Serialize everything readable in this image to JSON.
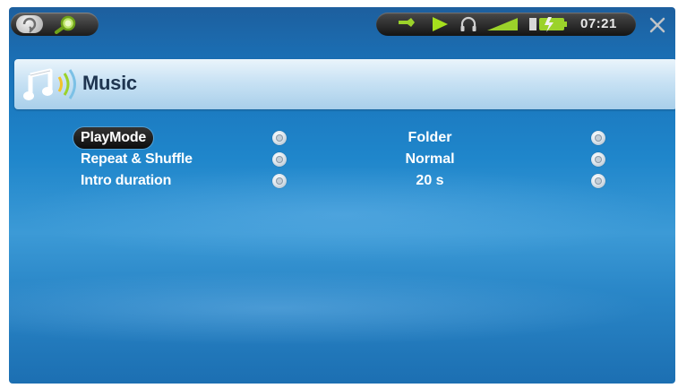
{
  "status_bar": {
    "clock": "07:21",
    "icons": [
      "back-icon",
      "search-icon",
      "usb-icon",
      "play-icon",
      "headphones-icon",
      "volume-icon",
      "battery-icon",
      "close-icon"
    ],
    "accent_green": "#9bd22a"
  },
  "header": {
    "title": "Music",
    "icon": "music-note-icon"
  },
  "settings": [
    {
      "label": "PlayMode",
      "value": "Folder",
      "selected": true
    },
    {
      "label": "Repeat & Shuffle",
      "value": "Normal",
      "selected": false
    },
    {
      "label": "Intro duration",
      "value": "20 s",
      "selected": false
    }
  ]
}
